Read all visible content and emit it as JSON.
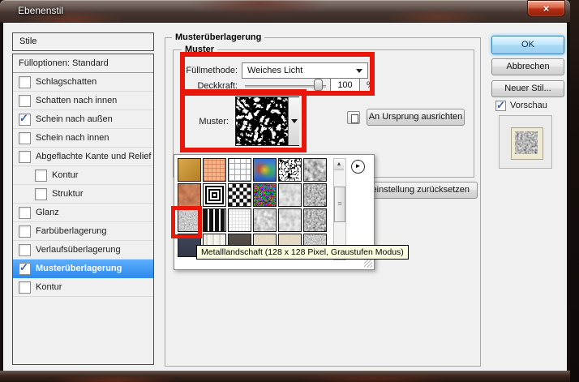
{
  "window": {
    "title": "Ebenenstil",
    "close": "×"
  },
  "sidebar": {
    "header": "Stile",
    "fill_options": "Fülloptionen: Standard",
    "items": [
      {
        "label": "Schlagschatten",
        "checked": false,
        "indent": false,
        "selected": false
      },
      {
        "label": "Schatten nach innen",
        "checked": false,
        "indent": false,
        "selected": false
      },
      {
        "label": "Schein nach außen",
        "checked": true,
        "indent": false,
        "selected": false
      },
      {
        "label": "Schein nach innen",
        "checked": false,
        "indent": false,
        "selected": false
      },
      {
        "label": "Abgeflachte Kante und Relief",
        "checked": false,
        "indent": false,
        "selected": false
      },
      {
        "label": "Kontur",
        "checked": false,
        "indent": true,
        "selected": false
      },
      {
        "label": "Struktur",
        "checked": false,
        "indent": true,
        "selected": false
      },
      {
        "label": "Glanz",
        "checked": false,
        "indent": false,
        "selected": false
      },
      {
        "label": "Farbüberlagerung",
        "checked": false,
        "indent": false,
        "selected": false
      },
      {
        "label": "Verlaufsüberlagerung",
        "checked": false,
        "indent": false,
        "selected": false
      },
      {
        "label": "Musterüberlagerung",
        "checked": true,
        "indent": false,
        "selected": true
      },
      {
        "label": "Kontur",
        "checked": false,
        "indent": false,
        "selected": false
      }
    ]
  },
  "main": {
    "group_title": "Musterüberlagerung",
    "inner_group_title": "Muster",
    "blend_label": "Füllmethode:",
    "blend_value": "Weiches Licht",
    "opacity_label": "Deckkraft:",
    "opacity_value": "100",
    "opacity_unit": "%",
    "pattern_label": "Muster:",
    "align_button": "An Ursprung ausrichten",
    "reset_button_visible_text": "einstellung zurücksetzen"
  },
  "actions": {
    "ok": "OK",
    "cancel": "Abbrechen",
    "new_style": "Neuer Stil...",
    "preview_label": "Vorschau",
    "preview_checked": true
  },
  "pattern_picker": {
    "tooltip": "Metalllandschaft (128 x 128 Pixel, Graustufen Modus)",
    "selected_swatch": "metal-landscape",
    "swatches": [
      "ochre",
      "orange-grid",
      "white-grid",
      "rainbow-blur",
      "ink-scribble",
      "gray-marble",
      "rust",
      "concentric-squares",
      "op-art-checker",
      "confetti",
      "soft-blobs",
      "dark-noise",
      "metal-landscape",
      "dash-rows",
      "faint-grid",
      "gray-blobs",
      "cloud-noise",
      "coarse-noise",
      "navy",
      "pale-stripes",
      "dark-weave",
      "sand",
      "sand-light",
      "gray-noise"
    ]
  },
  "annotations": {
    "highlight_color": "#e8170a",
    "regions": [
      "blend-and-opacity-controls",
      "pattern-thumbnail",
      "metal-landscape-swatch"
    ]
  },
  "colors": {
    "selection_blue": "#3399ff",
    "tooltip_bg": "#ffffe1",
    "ok_glow": "#59c0f5"
  }
}
